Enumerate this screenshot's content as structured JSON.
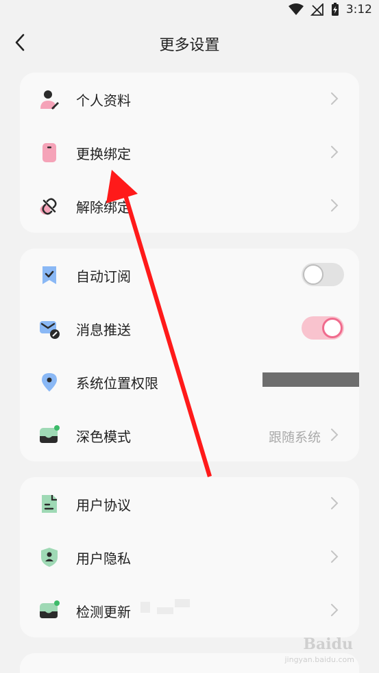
{
  "status_bar": {
    "time": "3:12"
  },
  "header": {
    "title": "更多设置"
  },
  "account_section": {
    "items": [
      {
        "label": "个人资料"
      },
      {
        "label": "更换绑定"
      },
      {
        "label": "解除绑定"
      }
    ]
  },
  "prefs_section": {
    "items": [
      {
        "label": "自动订阅",
        "toggle": "off"
      },
      {
        "label": "消息推送",
        "toggle": "on"
      },
      {
        "label": "系统位置权限",
        "value": ""
      },
      {
        "label": "深色模式",
        "value": "跟随系统"
      }
    ]
  },
  "about_section": {
    "items": [
      {
        "label": "用户协议"
      },
      {
        "label": "用户隐私"
      },
      {
        "label": "检测更新"
      }
    ]
  },
  "watermark": {
    "brand": "Baidu",
    "sub": "jingyan.baidu.com"
  },
  "colors": {
    "pink": "#f5a3b8",
    "blue": "#8ab8f5",
    "green": "#9fd9b5",
    "toggle_on": "#f06b8d",
    "arrow": "#ff1a1a"
  }
}
